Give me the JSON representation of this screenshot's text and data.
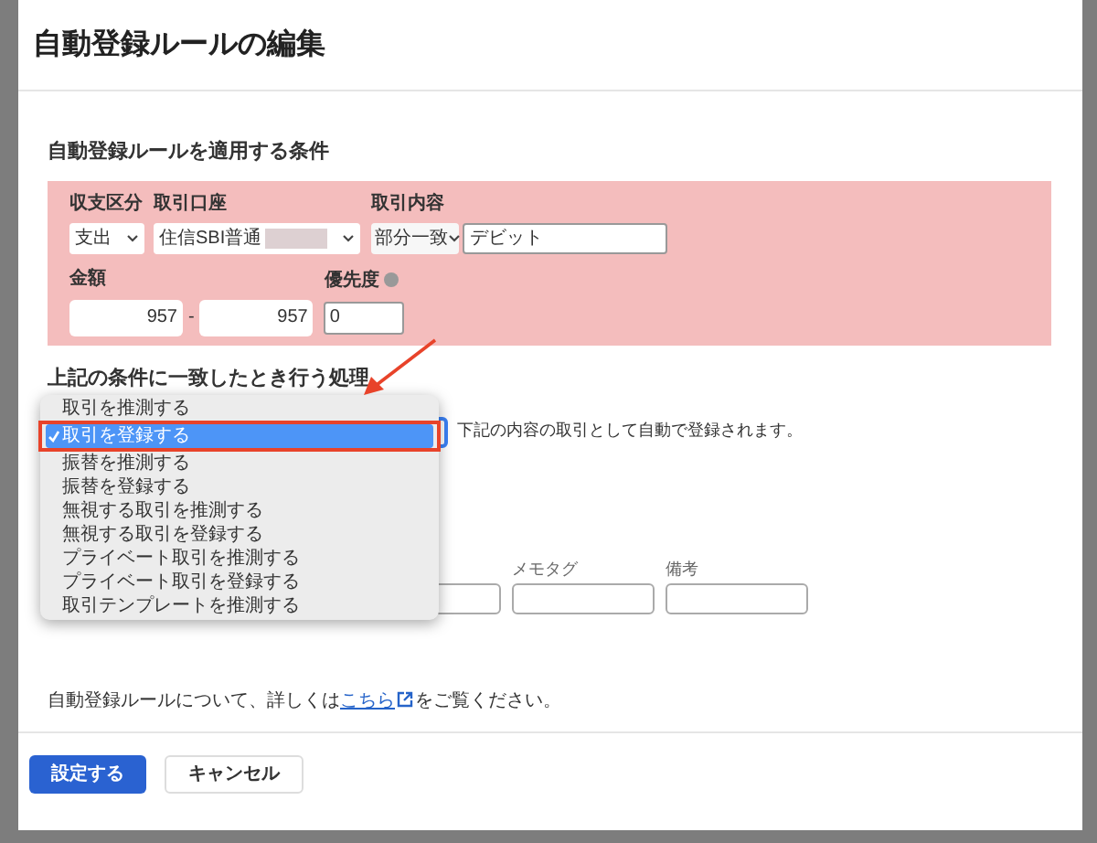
{
  "dialog": {
    "title": "自動登録ルールの編集"
  },
  "conditions": {
    "title": "自動登録ルールを適用する条件",
    "type": {
      "label": "収支区分",
      "value": "支出"
    },
    "account": {
      "label": "取引口座",
      "value": "住信SBI普通"
    },
    "description": {
      "label": "取引内容",
      "match": "部分一致",
      "value": "デビット"
    },
    "amount": {
      "label": "金額",
      "min": "957",
      "separator": "-",
      "max": "957"
    },
    "priority": {
      "label": "優先度",
      "value": "0"
    }
  },
  "action": {
    "title": "上記の条件に一致したとき行う処理",
    "help": "下記の内容の取引として自動で登録されます。",
    "options": [
      {
        "label": "取引を推測する",
        "selected": false
      },
      {
        "label": "取引を登録する",
        "selected": true
      },
      {
        "label": "振替を推測する",
        "selected": false
      },
      {
        "label": "振替を登録する",
        "selected": false
      },
      {
        "label": "無視する取引を推測する",
        "selected": false
      },
      {
        "label": "無視する取引を登録する",
        "selected": false
      },
      {
        "label": "プライベート取引を推測する",
        "selected": false
      },
      {
        "label": "プライベート取引を登録する",
        "selected": false
      },
      {
        "label": "取引テンプレートを推測する",
        "selected": false
      }
    ]
  },
  "fields": [
    {
      "kind": "input"
    },
    {
      "kind": "input",
      "label": "メモタグ"
    },
    {
      "kind": "input",
      "label": "備考"
    }
  ],
  "note": {
    "before": "自動登録ルールについて、詳しくは",
    "link": "こちら",
    "after": "をご覧ください。"
  },
  "buttons": [
    {
      "label": "設定する",
      "kind": "primary"
    },
    {
      "label": "キャンセル",
      "kind": "secondary"
    }
  ]
}
